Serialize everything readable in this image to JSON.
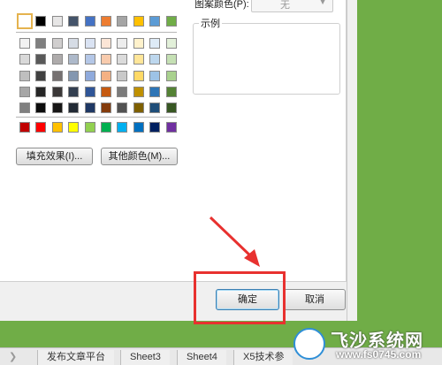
{
  "dialog": {
    "pattern_color_label": "图案颜色(P):",
    "pattern_color_value": "无",
    "sample_label": "示例",
    "fill_effects_button": "填充效果(I)...",
    "more_colors_button": "其他颜色(M)...",
    "ok_button": "确定",
    "cancel_button": "取消"
  },
  "palette": {
    "top_row": [
      "#ffffff",
      "#000000",
      "#e7e6e6",
      "#44546a",
      "#4472c4",
      "#ed7d31",
      "#a5a5a5",
      "#ffc000",
      "#5b9bd5",
      "#70ad47"
    ],
    "tints": [
      [
        "#f2f2f2",
        "#7f7f7f",
        "#d0cece",
        "#d6dce5",
        "#dae3f3",
        "#fbe5d6",
        "#ededed",
        "#fff2cc",
        "#deebf7",
        "#e2f0d9"
      ],
      [
        "#d9d9d9",
        "#595959",
        "#aeabab",
        "#adb9ca",
        "#b4c7e7",
        "#f8cbad",
        "#dbdbdb",
        "#ffe699",
        "#bdd7ee",
        "#c5e0b4"
      ],
      [
        "#bfbfbf",
        "#404040",
        "#767171",
        "#8497b0",
        "#8faadc",
        "#f4b183",
        "#c9c9c9",
        "#ffd966",
        "#9dc3e6",
        "#a9d18e"
      ],
      [
        "#a6a6a6",
        "#262626",
        "#3b3838",
        "#333f50",
        "#2f5597",
        "#c55a11",
        "#7b7b7b",
        "#bf9000",
        "#2e75b6",
        "#548235"
      ],
      [
        "#808080",
        "#0d0d0d",
        "#171616",
        "#222a35",
        "#1f3864",
        "#843c0c",
        "#525252",
        "#7f6000",
        "#1f4e79",
        "#385723"
      ]
    ],
    "standard": [
      "#c00000",
      "#ff0000",
      "#ffc000",
      "#ffff00",
      "#92d050",
      "#00b050",
      "#00b0f0",
      "#0070c0",
      "#002060",
      "#7030a0"
    ]
  },
  "sheet_tabs": [
    "发布文章平台",
    "Sheet3",
    "Sheet4",
    "X5技术参"
  ],
  "watermark": {
    "title": "飞沙系统网",
    "url": "www.fs0745.com"
  }
}
